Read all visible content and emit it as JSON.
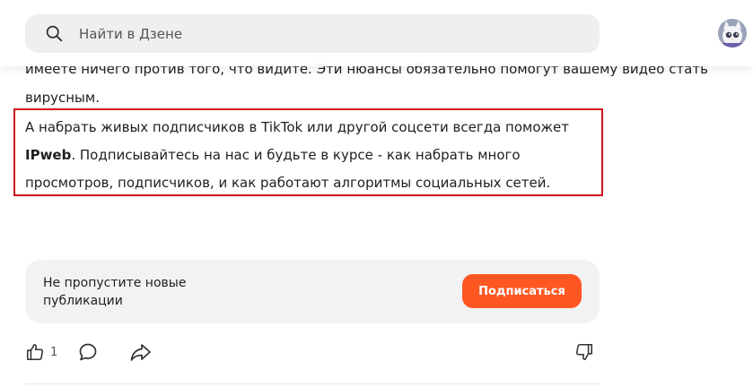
{
  "header": {
    "search_placeholder": "Найти в Дзене"
  },
  "article": {
    "faded_line": "имеете ничего  против того, что видите. Эти нюансы обязательно помогут вашему видео стать",
    "paragraph1": "вирусным.",
    "highlight_paragraph": {
      "before": "А набрать живых подписчиков в TikTok или другой соцсети всегда поможет ",
      "brand": "IPweb",
      "after": ". Подписывайтесь на нас и будьте в курсе - как набрать много просмотров, подписчиков, и как работают алгоритмы социальных сетей."
    },
    "highlight_color": "#d0141c"
  },
  "subscribe_card": {
    "text": "Не пропустите новые публикации",
    "button_label": "Подписаться",
    "button_color": "#ff5722"
  },
  "actions": {
    "like_count": "1",
    "icons": [
      "thumbs-up-icon",
      "comment-icon",
      "share-icon",
      "thumbs-down-icon"
    ]
  }
}
